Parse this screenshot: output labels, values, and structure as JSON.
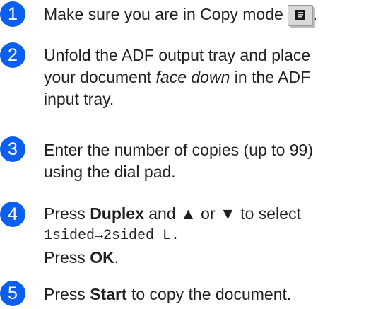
{
  "steps": [
    {
      "number": "1",
      "line1": "Make sure you are in Copy mode",
      "line1_after": "."
    },
    {
      "number": "2",
      "line1": "Unfold the ADF output tray and place",
      "line2_before": "your document ",
      "line2_emph": "face down",
      "line2_after": " in the ADF",
      "line3": "input tray."
    },
    {
      "number": "3",
      "line1": "Enter the number of copies (up to 99)",
      "line2": "using the dial pad."
    },
    {
      "number": "4",
      "line1_before": "Press ",
      "line1_bold": "Duplex",
      "line1_after": " and ▲ or ▼ to select",
      "line2_mono": "1sided→2sided L.",
      "line3_before": "Press ",
      "line3_bold": "OK",
      "line3_after": "."
    },
    {
      "number": "5",
      "line1_before": "Press ",
      "line1_bold": "Start",
      "line1_after": " to copy the document."
    }
  ],
  "icons": {
    "copy_mode": "copy-mode-icon"
  },
  "colors": {
    "badge": "#0a5ef0",
    "text": "#231f20"
  }
}
